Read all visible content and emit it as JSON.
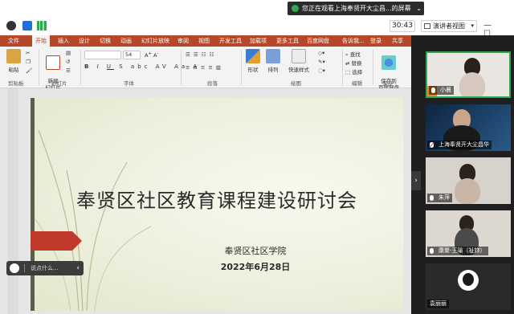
{
  "banner": {
    "text": "您正在观看上海奉贤开大尘昌...的屏幕"
  },
  "toolbar": {
    "timer": "30:43",
    "view_label": "演讲者视图"
  },
  "ribbon": {
    "tabs": [
      "文件",
      "开始",
      "插入",
      "设计",
      "切换",
      "动画",
      "幻灯片放映",
      "审阅",
      "视图",
      "开发工具",
      "加载项",
      "更多工具",
      "百度网盘",
      "告诉我...",
      "登录",
      "共享"
    ],
    "groups": [
      "剪贴板",
      "幻灯片",
      "字体",
      "段落",
      "绘图",
      "编辑",
      "保存"
    ],
    "buttons": {
      "paste": "粘贴",
      "new_slide": "新建\n幻灯片",
      "shape": "形状",
      "arrange": "排列",
      "quick_style": "快速样式",
      "find": "查找",
      "replace": "替换",
      "select": "选择",
      "save_baidu": "保存到\n百度网盘"
    },
    "font_size": "54"
  },
  "slide": {
    "title": "奉贤区社区教育课程建设研讨会",
    "org": "奉贤区社区学院",
    "date": "2022年6月28日"
  },
  "comment": {
    "placeholder": "说点什么..."
  },
  "participants": [
    {
      "name": "小晨",
      "mic": "on",
      "active": true
    },
    {
      "name": "上海奉贤开大尘昌华",
      "mic": "muted",
      "active": false
    },
    {
      "name": "朱萍",
      "mic": "on",
      "active": false
    },
    {
      "name": "康聚-王瑜（祉妳）",
      "mic": "on",
      "active": false
    },
    {
      "name": "袁丽丽",
      "mic": "none",
      "active": false
    }
  ],
  "colors": {
    "ribbon": "#b7472a",
    "active_border": "#2fa84f",
    "arrow": "#c0392b"
  }
}
